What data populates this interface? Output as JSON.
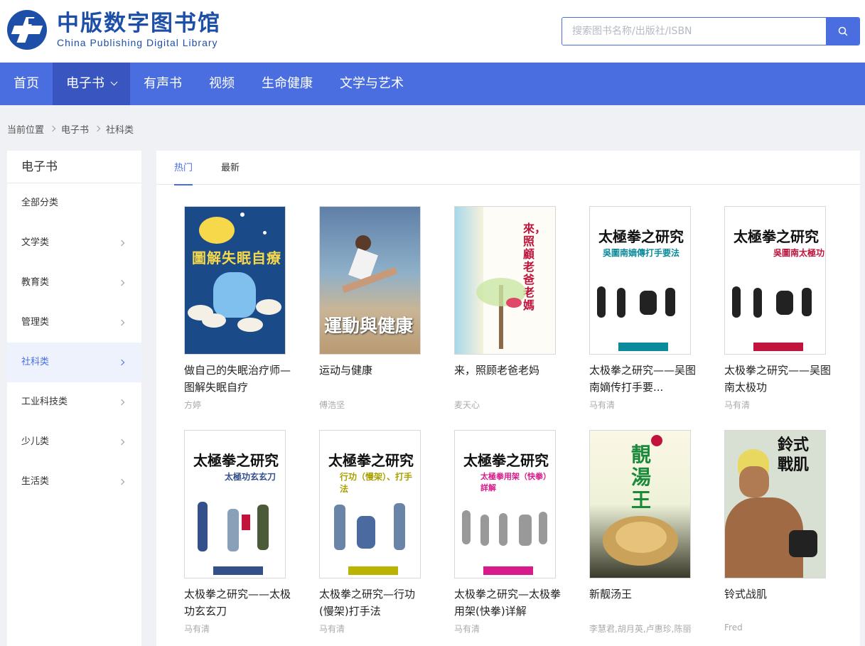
{
  "header": {
    "logo_cn": "中版数字图书馆",
    "logo_en": "China Publishing Digital Library",
    "search_placeholder": "搜索图书名称/出版社/ISBN"
  },
  "nav": [
    {
      "label": "首页",
      "active": false
    },
    {
      "label": "电子书",
      "active": true
    },
    {
      "label": "有声书",
      "active": false
    },
    {
      "label": "视频",
      "active": false
    },
    {
      "label": "生命健康",
      "active": false
    },
    {
      "label": "文学与艺术",
      "active": false
    }
  ],
  "breadcrumb": [
    "当前位置",
    "电子书",
    "社科类"
  ],
  "sidebar": {
    "title": "电子书",
    "items": [
      {
        "label": "全部分类"
      },
      {
        "label": "文学类"
      },
      {
        "label": "教育类"
      },
      {
        "label": "管理类"
      },
      {
        "label": "社科类"
      },
      {
        "label": "工业科技类"
      },
      {
        "label": "少儿类"
      },
      {
        "label": "生活类"
      }
    ]
  },
  "tabs": [
    {
      "label": "热门"
    },
    {
      "label": "最新"
    }
  ],
  "books": [
    {
      "title": "做自己的失眠治疗师—图解失眠自疗",
      "author": "方婷",
      "cover_title": "圖解失眠自療"
    },
    {
      "title": "运动与健康",
      "author": "傅浩坚",
      "cover_title": "運動與健康"
    },
    {
      "title": "来，照顾老爸老妈",
      "author": "麦天心",
      "cover_title": "來，照顧老爸老媽"
    },
    {
      "title": "太极拳之研究——吴图南嫡传打手要...",
      "author": "马有清",
      "cover_title": "太極拳之研究",
      "cover_sub": "吳圖南嫡傳打手要法"
    },
    {
      "title": "太极拳之研究——吴图南太极功",
      "author": "马有清",
      "cover_title": "太極拳之研究",
      "cover_sub": "吳圖南太極功"
    },
    {
      "title": "太极拳之研究——太极功玄玄刀",
      "author": "马有清",
      "cover_title": "太極拳之研究",
      "cover_sub": "太極功玄玄刀"
    },
    {
      "title": "太极拳之研究—行功(慢架)打手法",
      "author": "马有清",
      "cover_title": "太極拳之研究",
      "cover_sub": "行功（慢架）、打手法"
    },
    {
      "title": "太极拳之研究—太极拳用架(快拳)详解",
      "author": "马有清",
      "cover_title": "太極拳之研究",
      "cover_sub": "太極拳用架（快拳）詳解"
    },
    {
      "title": "新靓汤王",
      "author": "李慧君,胡月英,卢惠珍,陈丽",
      "cover_title": "靚湯王"
    },
    {
      "title": "铃式战肌",
      "author": "Fred",
      "cover_title": "鈴式戰肌"
    }
  ]
}
